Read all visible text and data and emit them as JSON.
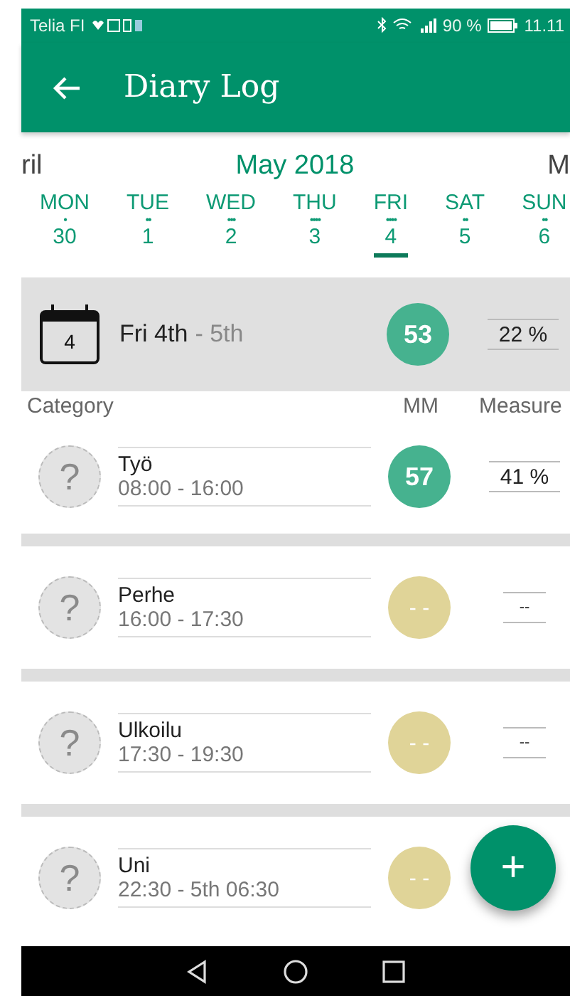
{
  "status_bar": {
    "carrier": "Telia FI",
    "battery": "90 %",
    "time": "11.11"
  },
  "app_bar": {
    "title": "Diary Log"
  },
  "calendar": {
    "prev_month": "ril",
    "month": "May 2018",
    "next_month": "M",
    "days": [
      {
        "name": "MON",
        "dots": "•",
        "date": "30",
        "selected": false
      },
      {
        "name": "TUE",
        "dots": "••",
        "date": "1",
        "selected": false
      },
      {
        "name": "WED",
        "dots": "•••",
        "date": "2",
        "selected": false
      },
      {
        "name": "THU",
        "dots": "••••",
        "date": "3",
        "selected": false
      },
      {
        "name": "FRI",
        "dots": "••••",
        "date": "4",
        "selected": true
      },
      {
        "name": "SAT",
        "dots": "••",
        "date": "5",
        "selected": false
      },
      {
        "name": "SUN",
        "dots": "••",
        "date": "6",
        "selected": false
      }
    ]
  },
  "summary": {
    "icon_date": "4",
    "day": "Fri 4th",
    "range_end": "- 5th",
    "mm": "53",
    "measured": "22 %"
  },
  "columns": [
    "Category",
    "MM",
    "Measure"
  ],
  "entries": [
    {
      "avatar": "?",
      "name": "Työ",
      "time": "08:00 - 16:00",
      "mm": "57",
      "rated": true,
      "measured": "41 %"
    },
    {
      "avatar": "?",
      "name": "Perhe",
      "time": "16:00 - 17:30",
      "mm": "- -",
      "rated": false,
      "measured": "--"
    },
    {
      "avatar": "?",
      "name": "Ulkoilu",
      "time": "17:30 - 19:30",
      "mm": "- -",
      "rated": false,
      "measured": "--"
    },
    {
      "avatar": "?",
      "name": "Uni",
      "time": "22:30 - 5th 06:30",
      "mm": "- -",
      "rated": false
    }
  ],
  "fab": {
    "label": "+"
  }
}
